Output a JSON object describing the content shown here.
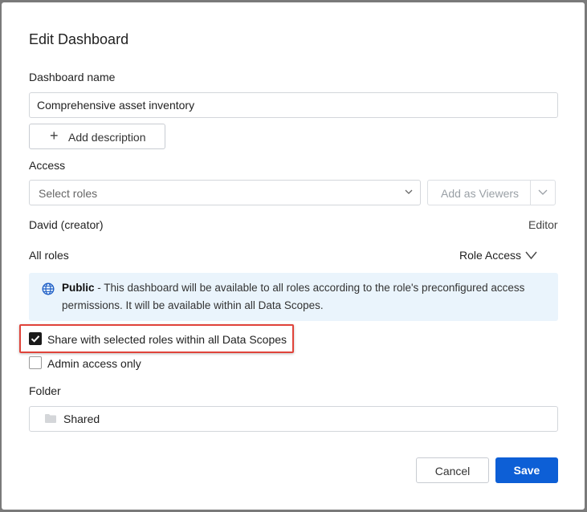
{
  "dialog": {
    "title": "Edit Dashboard",
    "name_label": "Dashboard name",
    "name_value": "Comprehensive asset inventory",
    "add_description": "Add description",
    "access_label": "Access",
    "select_roles_placeholder": "Select roles",
    "add_as_viewers": "Add as Viewers",
    "creator_name": "David (creator)",
    "creator_role": "Editor",
    "all_roles": "All roles",
    "role_access": "Role Access",
    "info": {
      "bold": "Public",
      "line1": " - This dashboard will be available to all roles according to the role's preconfigured access",
      "line2": "permissions. It will be available within all Data Scopes."
    },
    "share_checkbox_label": "Share with selected roles within all Data Scopes",
    "share_checked": true,
    "admin_checkbox_label": "Admin access only",
    "admin_checked": false,
    "folder_label": "Folder",
    "folder_value": "Shared",
    "cancel_label": "Cancel",
    "save_label": "Save"
  },
  "colors": {
    "primary": "#0d5fd6",
    "info_bg": "#eaf4fc",
    "highlight": "#e0433a"
  },
  "icons": [
    "plus-icon",
    "chevron-down-icon",
    "globe-icon",
    "checkmark-icon",
    "folder-icon"
  ]
}
